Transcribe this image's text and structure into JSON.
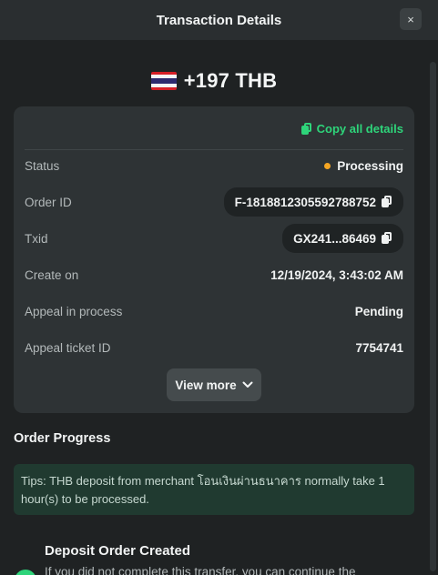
{
  "header": {
    "title": "Transaction Details",
    "close_icon": "×"
  },
  "summary": {
    "currency_flag": "thailand-flag-icon",
    "amount": "+197 THB"
  },
  "details": {
    "copy_all_label": "Copy all details",
    "rows": [
      {
        "label": "Status",
        "value": "Processing",
        "status_color": "#f5a623"
      },
      {
        "label": "Order ID",
        "value": "F-181881230559278875​2"
      },
      {
        "label": "Txid",
        "value": "GX241...86469"
      },
      {
        "label": "Create on",
        "value": "12/19/2024, 3:43:02 AM"
      },
      {
        "label": "Appeal in process",
        "value": "Pending"
      },
      {
        "label": "Appeal ticket ID",
        "value": "7754741"
      }
    ],
    "view_more_label": "View more",
    "view_more_icon": "⌄"
  },
  "order_progress": {
    "title": "Order Progress",
    "tips": "Tips: THB deposit from merchant โอนเงินผ่านธนาคาร normally take 1 hour(s) to be processed.",
    "steps": [
      {
        "title": "Deposit Order Created",
        "description": "If you did not complete this transfer, you can continue the"
      }
    ]
  },
  "colors": {
    "accent_green": "#2ed47a",
    "status_pending": "#f5a623",
    "background": "#1f2223",
    "card": "#2e3335"
  }
}
